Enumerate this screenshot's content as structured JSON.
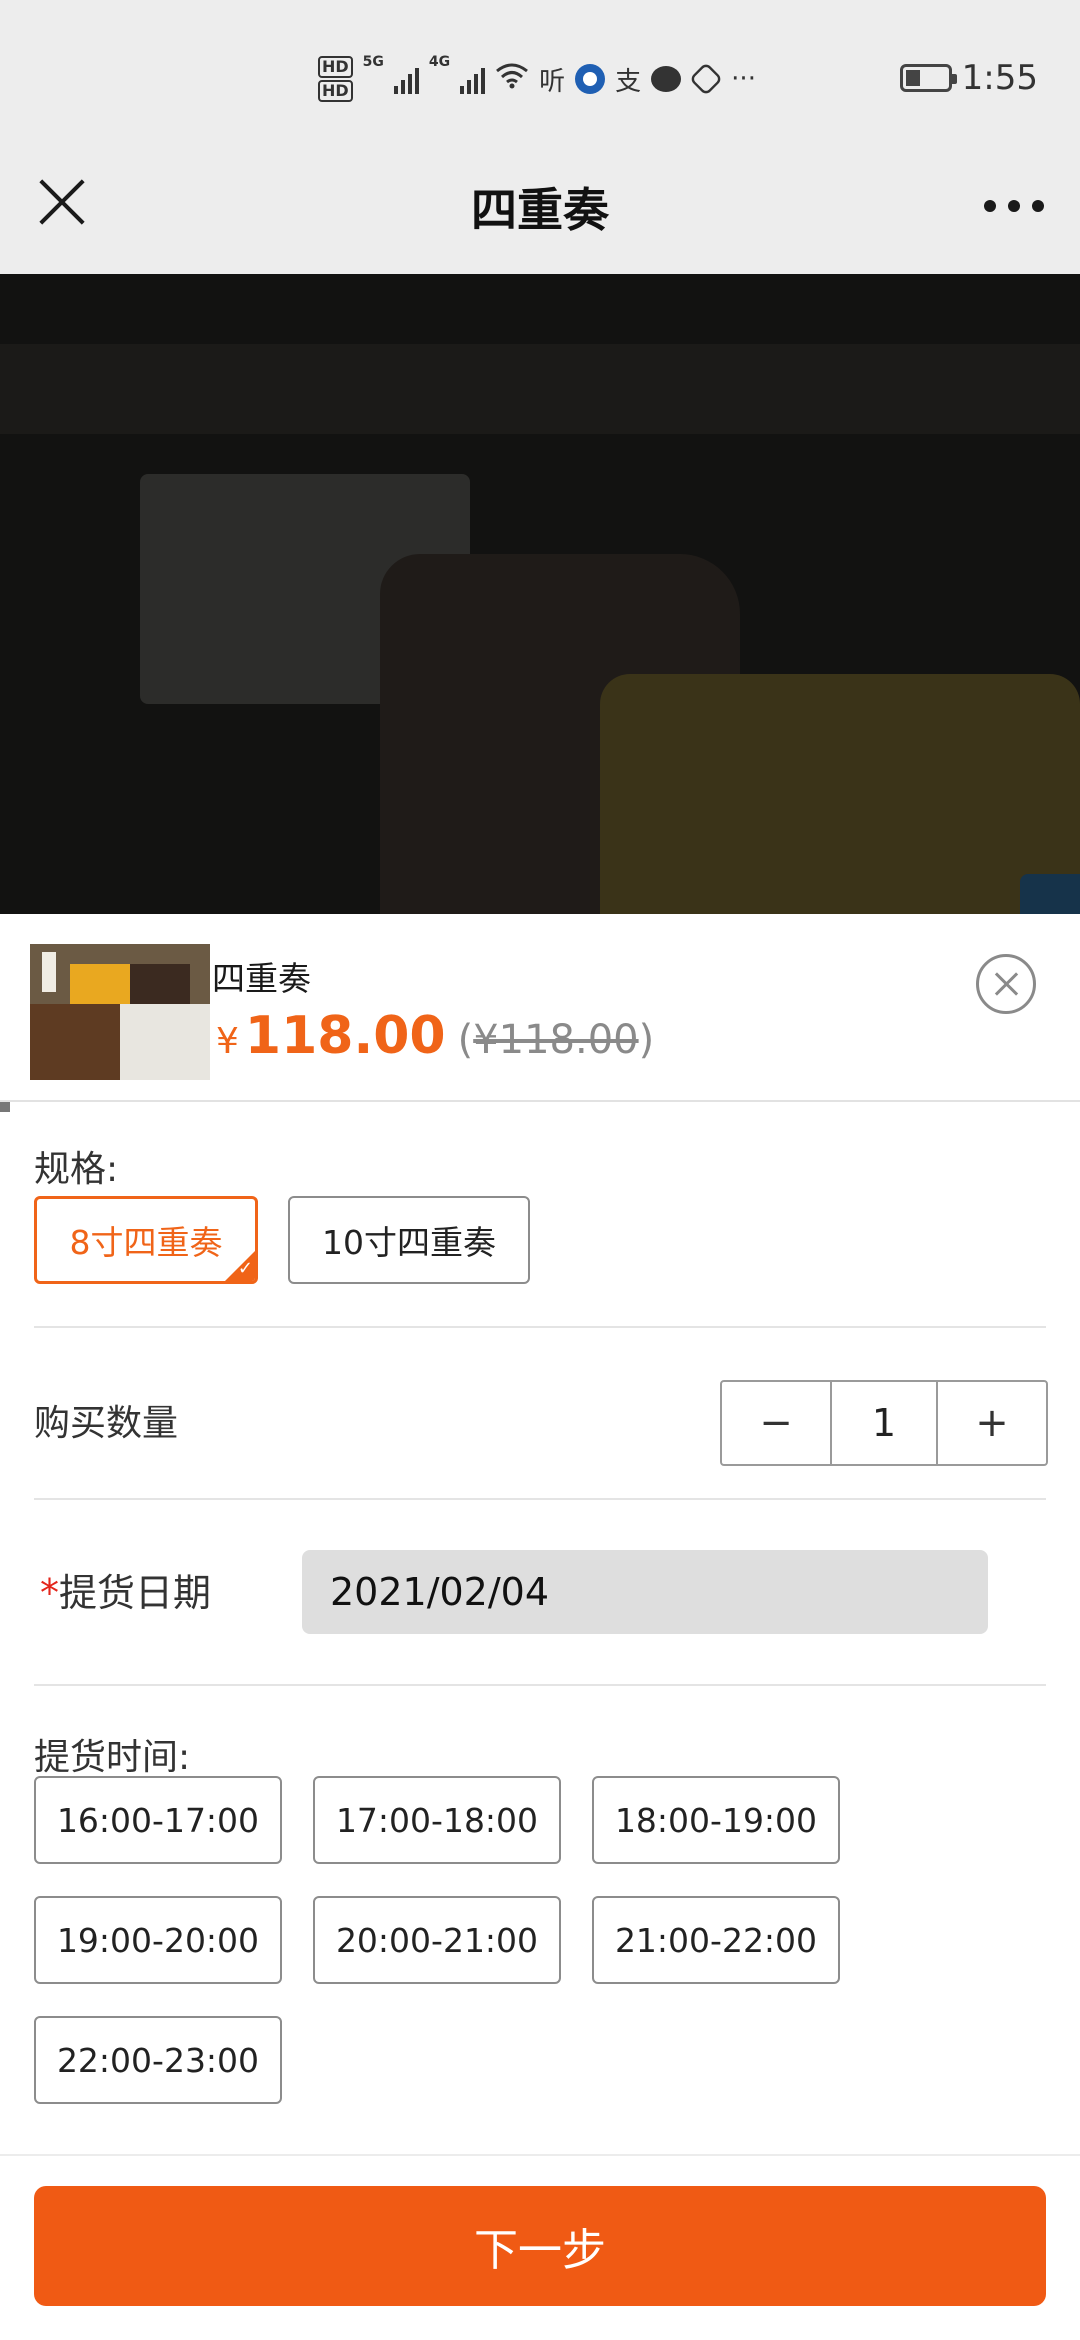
{
  "status_bar": {
    "hd1": "HD",
    "hd2": "HD",
    "net1": "5G",
    "net2": "4G",
    "app_label_1": "听",
    "app_label_2": "支",
    "more": "···",
    "time": "1:55",
    "battery_level": 0.3
  },
  "header": {
    "title": "四重奏"
  },
  "product": {
    "name": "四重奏",
    "currency": "¥",
    "price": "118.00",
    "old_price_open": "(",
    "old_price": "¥118.00",
    "old_price_close": ")"
  },
  "spec": {
    "label": "规格:",
    "options": [
      "8寸四重奏",
      "10寸四重奏"
    ],
    "selected_index": 0
  },
  "quantity": {
    "label": "购买数量",
    "minus": "−",
    "value": "1",
    "plus": "+"
  },
  "pickup_date": {
    "required_mark": "*",
    "label": "提货日期",
    "value": "2021/02/04"
  },
  "pickup_time": {
    "label": "提货时间:",
    "slots": [
      "16:00-17:00",
      "17:00-18:00",
      "18:00-19:00",
      "19:00-20:00",
      "20:00-21:00",
      "21:00-22:00",
      "22:00-23:00"
    ]
  },
  "footer": {
    "next_label": "下一步"
  },
  "colors": {
    "accent": "#f06418",
    "button": "#f05a14",
    "required": "#e3251b"
  }
}
